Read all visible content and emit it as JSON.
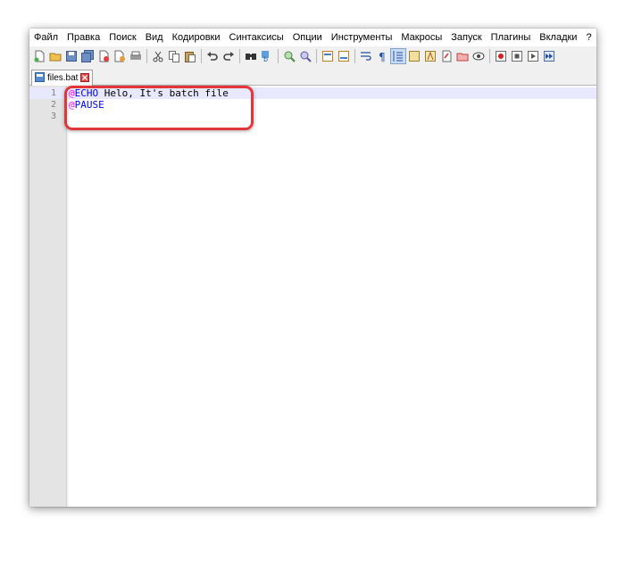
{
  "menu": [
    "Файл",
    "Правка",
    "Поиск",
    "Вид",
    "Кодировки",
    "Синтаксисы",
    "Опции",
    "Инструменты",
    "Макросы",
    "Запуск",
    "Плагины",
    "Вкладки",
    "?"
  ],
  "toolbar": {
    "groups": [
      [
        "new-file",
        "open-file",
        "save",
        "save-all",
        "close",
        "close-all",
        "print"
      ],
      [
        "cut",
        "copy",
        "paste"
      ],
      [
        "undo",
        "redo"
      ],
      [
        "find",
        "replace"
      ],
      [
        "zoom-in",
        "zoom-out"
      ],
      [
        "sync-vertical",
        "sync-horizontal"
      ],
      [
        "word-wrap",
        "show-all-chars",
        "indent-guide",
        "user-defined-lang",
        "function-list",
        "doc-map",
        "folder-workspace",
        "monitor"
      ],
      [
        "record-macro",
        "stop-record",
        "play-macro",
        "run-macro-multiple"
      ]
    ]
  },
  "tab": {
    "label": "files.bat",
    "icon": "document-icon",
    "close_icon": "close-icon"
  },
  "editor": {
    "lines": [
      {
        "number": "1",
        "at": "@",
        "keyword": "ECHO",
        "rest": " Helo, It's batch file"
      },
      {
        "number": "2",
        "at": "@",
        "keyword": "PAUSE",
        "rest": ""
      },
      {
        "number": "3",
        "at": "",
        "keyword": "",
        "rest": ""
      }
    ]
  },
  "colors": {
    "accent_highlight": "#e2363b",
    "keyword": "#0000ff",
    "at_sign": "#ff00ff",
    "current_line": "#e8e8ff"
  }
}
